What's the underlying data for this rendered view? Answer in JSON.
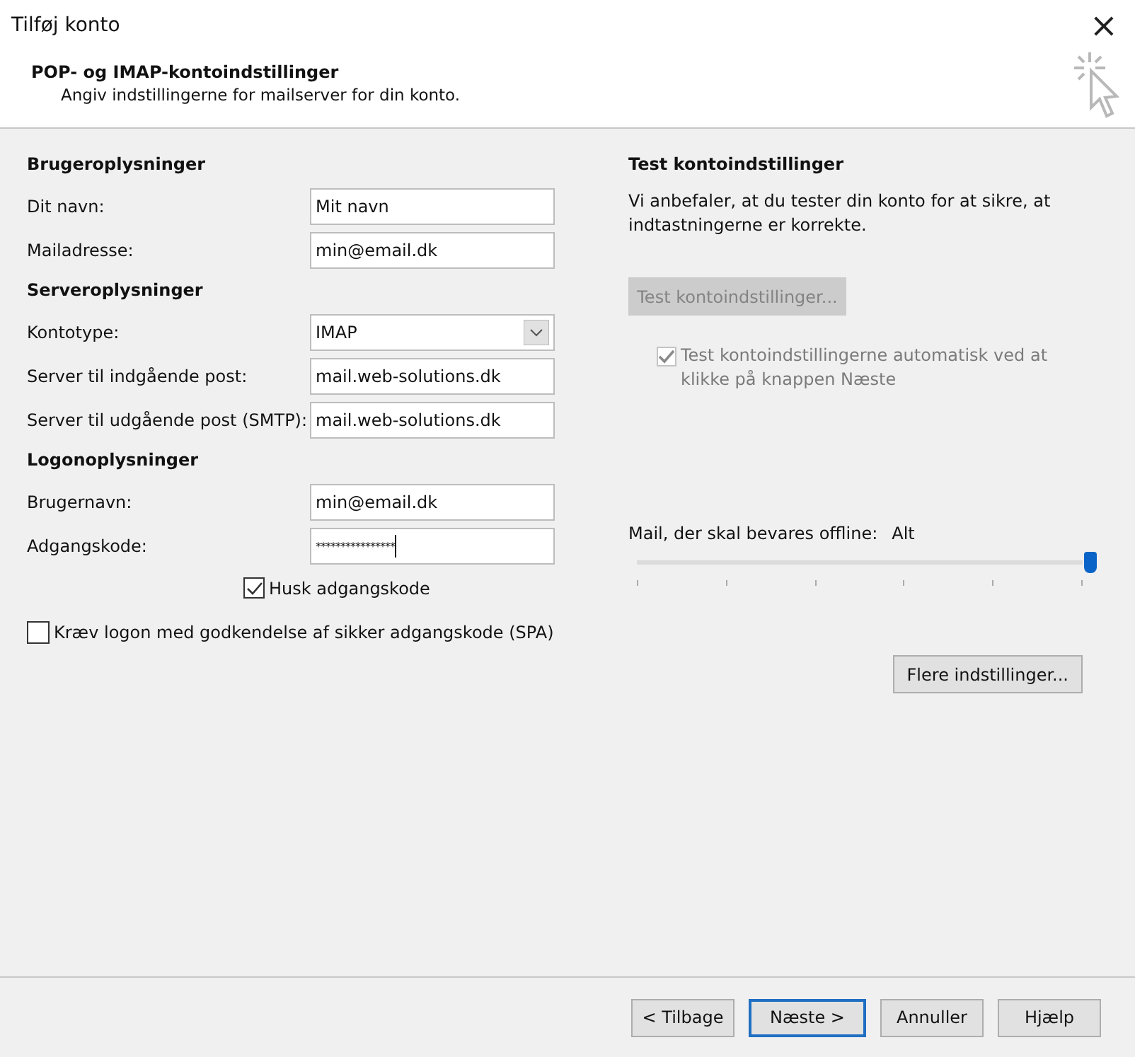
{
  "window": {
    "title": "Tilføj konto",
    "close": "×"
  },
  "header": {
    "title": "POP- og IMAP-kontoindstillinger",
    "subtitle": "Angiv indstillingerne for mailserver for din konto."
  },
  "sections": [
    {
      "title": "Brugeroplysninger",
      "fields": [
        {
          "kind": "text",
          "label": "Dit navn:",
          "value": "Mit navn"
        },
        {
          "kind": "text",
          "label": "Mailadresse:",
          "value": "min@email.dk"
        }
      ]
    },
    {
      "title": "Serveroplysninger",
      "fields": [
        {
          "kind": "select",
          "label": "Kontotype:",
          "value": "IMAP"
        },
        {
          "kind": "text",
          "label": "Server til indgående post:",
          "value": "mail.web-solutions.dk"
        },
        {
          "kind": "text",
          "label": "Server til udgående post (SMTP):",
          "value": "mail.web-solutions.dk"
        }
      ]
    },
    {
      "title": "Logonoplysninger",
      "fields": [
        {
          "kind": "text",
          "label": "Brugernavn:",
          "value": "min@email.dk"
        },
        {
          "kind": "password",
          "label": "Adgangskode:",
          "value": "****************"
        }
      ]
    }
  ],
  "remember_password": {
    "label": "Husk adgangskode",
    "checked": true
  },
  "spa": {
    "label": "Kræv logon med godkendelse af sikker adgangskode (SPA)",
    "checked": false
  },
  "test": {
    "title": "Test kontoindstillinger",
    "description": "Vi anbefaler, at du tester din konto for at sikre, at indtastningerne er korrekte.",
    "button": {
      "label": "Test kontoindstillinger...",
      "disabled": true
    },
    "auto_test": {
      "label": "Test kontoindstillingerne automatisk ved at klikke på knappen Næste",
      "checked": true,
      "disabled": true
    }
  },
  "offline": {
    "label": "Mail, der skal bevares offline:",
    "reading": "Alt",
    "level": 1
  },
  "more_button": "Flere indstillinger...",
  "buttons": [
    {
      "label": "< Tilbage",
      "focused": false
    },
    {
      "label": "Næste >",
      "focused": true
    },
    {
      "label": "Annuller",
      "focused": false
    },
    {
      "label": "Hjælp",
      "focused": false
    }
  ]
}
